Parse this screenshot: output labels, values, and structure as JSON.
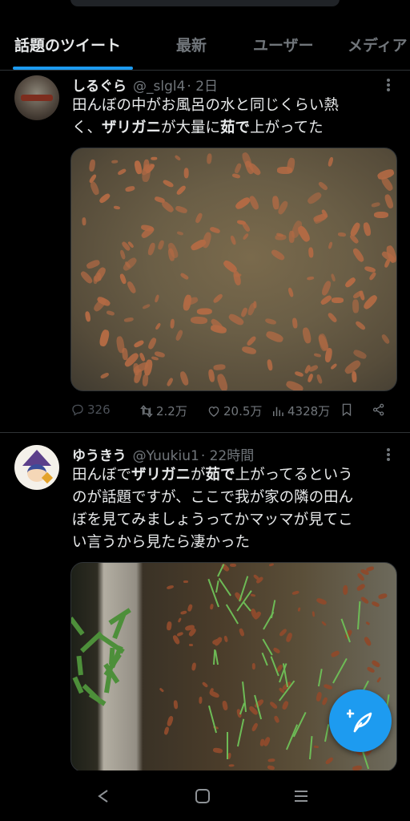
{
  "tabs": [
    {
      "label": "話題のツイート",
      "active": true
    },
    {
      "label": "最新",
      "active": false
    },
    {
      "label": "ユーザー",
      "active": false
    },
    {
      "label": "メディア",
      "active": false
    }
  ],
  "tweets": [
    {
      "display_name": "しるぐら",
      "handle": "@_slgl4",
      "time": "· 2日",
      "text": {
        "line1": "田んぼの中がお風呂の水と同じくらい熱",
        "line2_pre": "く、",
        "line2_bold1": "ザリガニ",
        "line2_mid": "が大量に",
        "line2_bold2": "茹で",
        "line2_post": "上がってた"
      },
      "actions": {
        "replies": "326",
        "retweets": "2.2万",
        "likes": "20.5万",
        "views": "4328万"
      }
    },
    {
      "display_name": "ゆうきう",
      "handle": "@Yuukiu1",
      "time": "· 22時間",
      "text": {
        "l1_pre": "田んぼで",
        "l1_bold1": "ザリガニ",
        "l1_mid": "が",
        "l1_bold2": "茹で",
        "l1_post": "上がってるという",
        "line2": "のが話題ですが、ここで我が家の隣の田ん",
        "line3": "ぼを見てみましょうってかマッマが見てこ",
        "line4": "い言うから見たら凄かった"
      }
    }
  ],
  "icons": {
    "reply": "reply-icon",
    "retweet": "retweet-icon",
    "like": "heart-icon",
    "views": "views-icon",
    "bookmark": "bookmark-icon",
    "share": "share-icon",
    "compose": "compose-tweet-icon",
    "nav_back": "nav-back-icon",
    "nav_home": "nav-home-icon",
    "nav_menu": "nav-menu-icon"
  },
  "colors": {
    "accent": "#1d9bf0",
    "background": "#000000",
    "secondary_text": "#71767b"
  }
}
